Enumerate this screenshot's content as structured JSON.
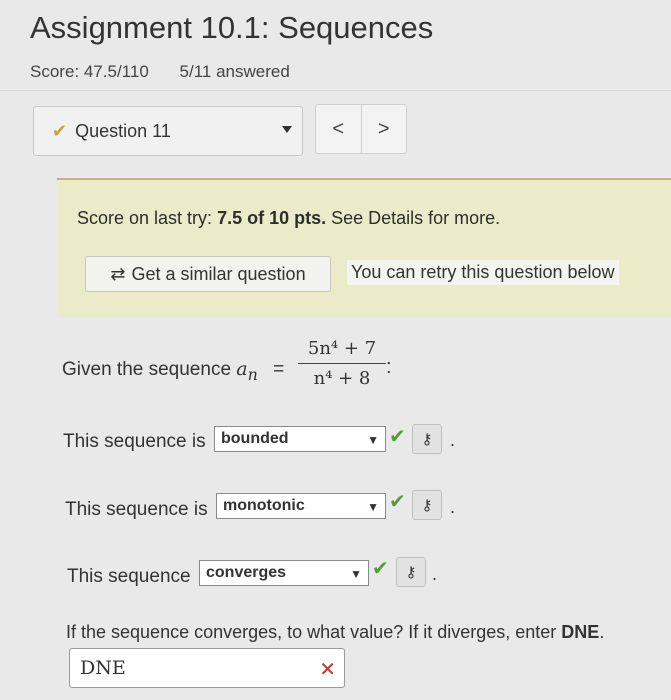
{
  "header": {
    "title": "Assignment 10.1: Sequences",
    "score": "Score: 47.5/110",
    "answered": "5/11 answered"
  },
  "question_nav": {
    "selected": "Question 11",
    "prev": "<",
    "next": ">"
  },
  "banner": {
    "score_prefix": "Score on last try: ",
    "score_value": "7.5 of 10 pts.",
    "score_suffix": " See Details for more.",
    "similar_button": "Get a similar question",
    "retry_text": "You can retry this question below"
  },
  "problem": {
    "given_prefix": "Given the sequence ",
    "an": "a",
    "an_sub": "n",
    "equals": "=",
    "numerator": "5n⁴ + 7",
    "denominator": "n⁴ + 8",
    "colon": ":"
  },
  "parts": [
    {
      "label": "This sequence is",
      "value": "bounded",
      "period": "."
    },
    {
      "label": "This sequence is",
      "value": "monotonic",
      "period": "."
    },
    {
      "label": "This sequence",
      "value": "converges",
      "period": "."
    }
  ],
  "limit": {
    "question_prefix": "If the sequence converges, to what value? If it diverges, enter ",
    "question_bold": "DNE",
    "question_suffix": ".",
    "answer": "DNE"
  }
}
